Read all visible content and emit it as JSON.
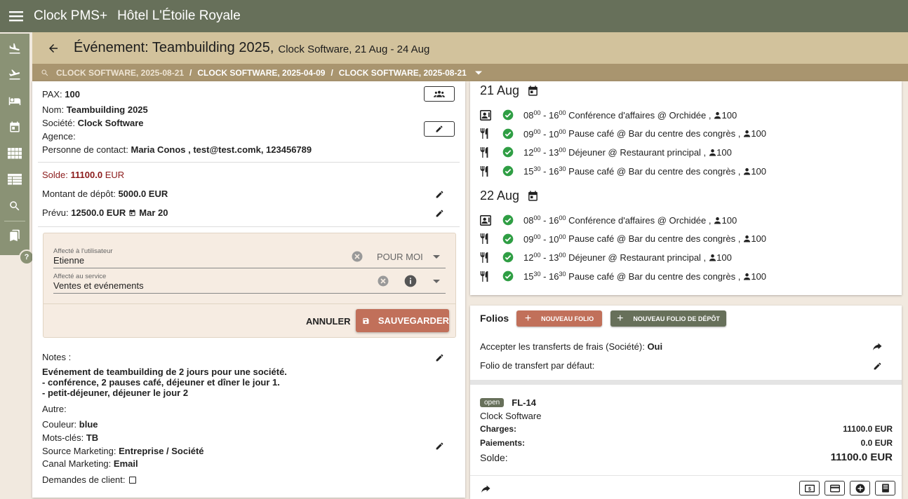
{
  "app": {
    "name": "Clock PMS+",
    "hotel": "Hôtel L'Étoile Royale"
  },
  "header": {
    "title": "Événement: Teambuilding 2025,",
    "subtitle": "Clock Software, 21 Aug - 24 Aug"
  },
  "breadcrumb": [
    "CLOCK SOFTWARE, 2025-08-21",
    "CLOCK SOFTWARE, 2025-04-09",
    "CLOCK SOFTWARE, 2025-08-21"
  ],
  "sidebar": {
    "items": [
      "arrivals-icon",
      "departures-icon",
      "in-house-icon",
      "calendar-icon",
      "grid-icon",
      "table-icon",
      "search-icon",
      "bookmarks-icon"
    ],
    "help": "?"
  },
  "details": {
    "pax_label": "PAX:",
    "pax_value": "100",
    "nom_label": "Nom:",
    "nom_value": "Teambuilding 2025",
    "societe_label": "Société:",
    "societe_value": "Clock Software",
    "agence_label": "Agence:",
    "contact_label": "Personne de contact:",
    "contact_value": "Maria Conos , test@test.comk, 123456789"
  },
  "balance": {
    "solde_label": "Solde:",
    "solde_value": "11100.0",
    "solde_currency": "EUR",
    "depot_label": "Montant de dépôt:",
    "depot_value": "5000.0 EUR",
    "prevu_label": "Prévu:",
    "prevu_value": "12500.0 EUR",
    "prevu_date": "Mar 20"
  },
  "assignment": {
    "user_label": "Affecté à l'utilisateur",
    "user_value": "Etienne",
    "pour_moi": "POUR MOI",
    "service_label": "Affecté au service",
    "service_value": "Ventes et evénements",
    "cancel": "ANNULER",
    "save": "SAUVEGARDER"
  },
  "notes": {
    "label": "Notes :",
    "lines": [
      "Evénement de teambuilding de 2 jours pour une société.",
      "- conférence, 2 pauses café, déjeuner et dîner le jour 1.",
      "- petit-déjeuner, déjeuner le jour 2"
    ],
    "autre_label": "Autre:",
    "couleur_label": "Couleur:",
    "couleur_value": "blue",
    "mots_label": "Mots-clés:",
    "mots_value": "TB",
    "source_label": "Source Marketing:",
    "source_value": "Entreprise / Société",
    "canal_label": "Canal Marketing:",
    "canal_value": "Email",
    "demandes_label": "Demandes de client:"
  },
  "schedule": {
    "days": [
      {
        "title": "21 Aug",
        "items": [
          {
            "type": "conference",
            "sh": "08",
            "sm": "00",
            "eh": "16",
            "em": "00",
            "text": "Conférence d'affaires @ Orchidée ,",
            "pax": "100"
          },
          {
            "type": "meal",
            "sh": "09",
            "sm": "00",
            "eh": "10",
            "em": "00",
            "text": "Pause café @ Bar du centre des congrès ,",
            "pax": "100"
          },
          {
            "type": "meal",
            "sh": "12",
            "sm": "00",
            "eh": "13",
            "em": "00",
            "text": "Déjeuner @ Restaurant principal ,",
            "pax": "100"
          },
          {
            "type": "meal",
            "sh": "15",
            "sm": "30",
            "eh": "16",
            "em": "30",
            "text": "Pause café @ Bar du centre des congrès ,",
            "pax": "100"
          }
        ]
      },
      {
        "title": "22 Aug",
        "items": [
          {
            "type": "conference",
            "sh": "08",
            "sm": "00",
            "eh": "16",
            "em": "00",
            "text": "Conférence d'affaires @ Orchidée ,",
            "pax": "100"
          },
          {
            "type": "meal",
            "sh": "09",
            "sm": "00",
            "eh": "10",
            "em": "00",
            "text": "Pause café @ Bar du centre des congrès ,",
            "pax": "100"
          },
          {
            "type": "meal",
            "sh": "12",
            "sm": "00",
            "eh": "13",
            "em": "00",
            "text": "Déjeuner @ Restaurant principal ,",
            "pax": "100"
          },
          {
            "type": "meal",
            "sh": "15",
            "sm": "30",
            "eh": "16",
            "em": "30",
            "text": "Pause café @ Bar du centre des congrès ,",
            "pax": "100"
          }
        ]
      }
    ]
  },
  "folios": {
    "title": "Folios",
    "new_folio": "NOUVEAU FOLIO",
    "new_deposit_folio": "NOUVEAU FOLIO DE DÉPÔT",
    "accept_label": "Accepter les transferts de frais (Société):",
    "accept_value": "Oui",
    "default_label": "Folio de transfert par défaut:",
    "folio": {
      "status": "open",
      "number": "FL-14",
      "owner": "Clock Software",
      "charges_label": "Charges:",
      "charges_value": "11100.0 EUR",
      "paiements_label": "Paiements:",
      "paiements_value": "0.0 EUR",
      "solde_label": "Solde:",
      "solde_value": "11100.0 EUR"
    }
  },
  "colors": {
    "topbar": "#67705a",
    "header": "#d2c29c",
    "crumb": "#a9956f",
    "accent": "#c1705a",
    "success": "#2f9e44",
    "danger": "#8b1a1a"
  }
}
